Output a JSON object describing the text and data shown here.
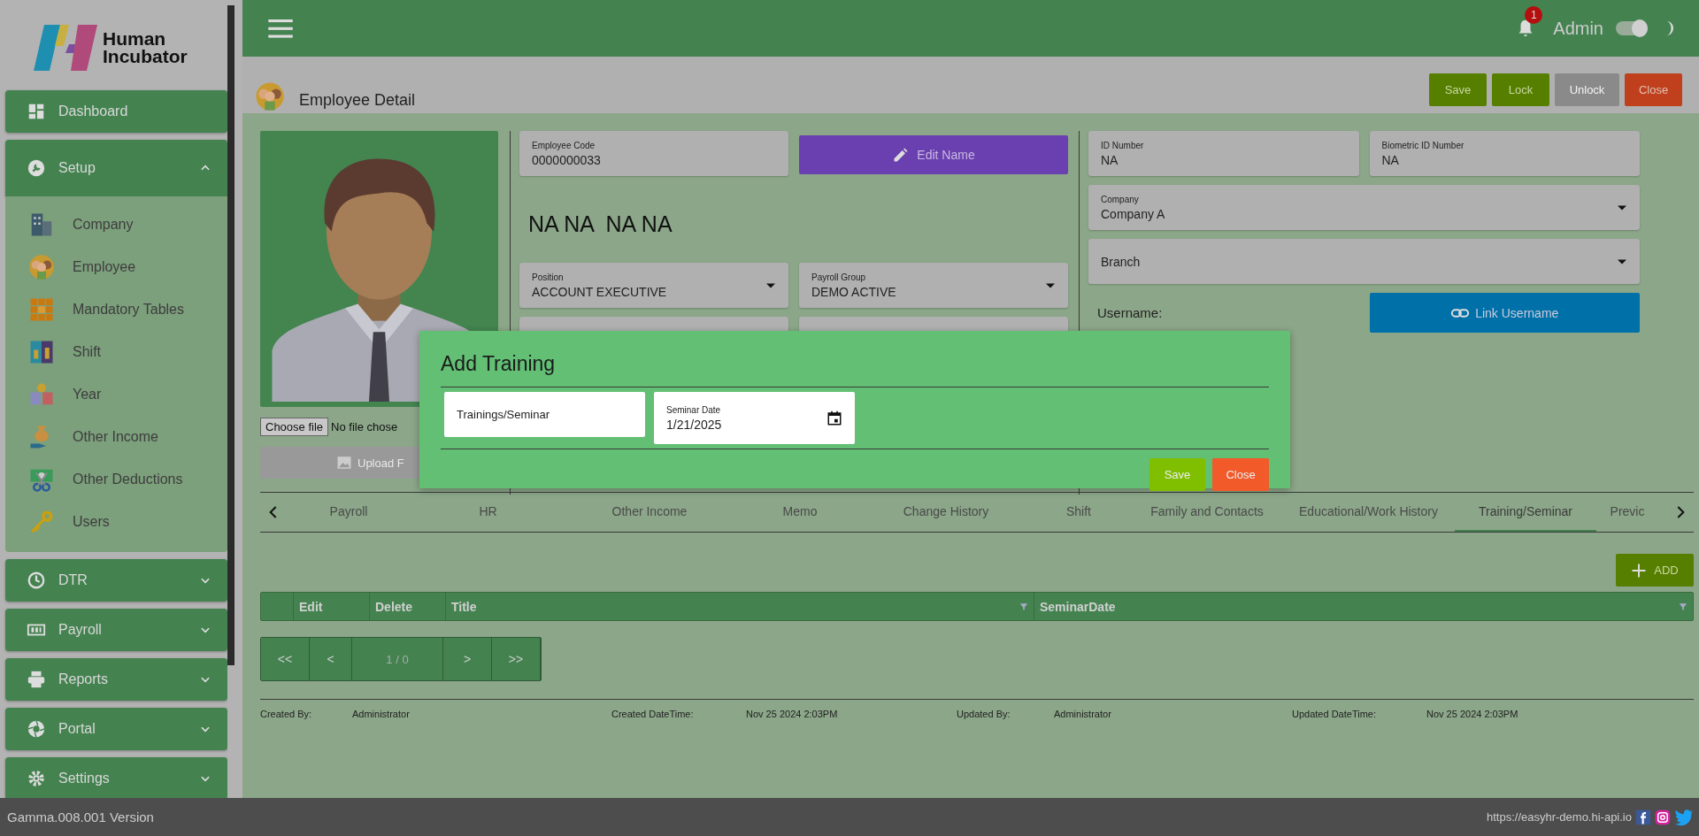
{
  "sidebar": {
    "logo": {
      "line1": "Human",
      "line2": "Incubator"
    },
    "items": [
      {
        "label": "Dashboard",
        "kind": "link"
      },
      {
        "label": "Setup",
        "kind": "group",
        "expanded": true,
        "children": [
          {
            "label": "Company"
          },
          {
            "label": "Employee"
          },
          {
            "label": "Mandatory Tables"
          },
          {
            "label": "Shift"
          },
          {
            "label": "Year"
          },
          {
            "label": "Other Income"
          },
          {
            "label": "Other Deductions"
          },
          {
            "label": "Users"
          }
        ]
      },
      {
        "label": "DTR",
        "kind": "group",
        "expanded": false
      },
      {
        "label": "Payroll",
        "kind": "group",
        "expanded": false
      },
      {
        "label": "Reports",
        "kind": "group",
        "expanded": false
      },
      {
        "label": "Portal",
        "kind": "group",
        "expanded": false
      },
      {
        "label": "Settings",
        "kind": "group",
        "expanded": false
      }
    ],
    "version": "Gamma.008.001 Version"
  },
  "topbar": {
    "notifications": "1",
    "user": "Admin",
    "theme_toggle": {
      "on": true
    }
  },
  "page": {
    "title": "Employee Detail",
    "actions": [
      {
        "label": "Save",
        "kind": "save",
        "disabled": false
      },
      {
        "label": "Lock",
        "kind": "save",
        "disabled": false
      },
      {
        "label": "Unlock",
        "kind": "save",
        "disabled": true
      },
      {
        "label": "Close",
        "kind": "close",
        "disabled": false
      }
    ]
  },
  "profile": {
    "choose_file": "Choose file",
    "file_status": "No file chose",
    "upload": "Upload F"
  },
  "employee": {
    "code": {
      "label": "Employee Code",
      "value": "0000000033"
    },
    "edit_name": "Edit Name",
    "name": "NA NA  NA NA",
    "position": {
      "label": "Position",
      "value": "ACCOUNT EXECUTIVE"
    },
    "payroll_group": {
      "label": "Payroll Group",
      "value": "DEMO ACTIVE"
    },
    "id_number": {
      "label": "ID Number",
      "value": "NA"
    },
    "biometric_id": {
      "label": "Biometric ID Number",
      "value": "NA"
    },
    "company": {
      "label": "Company",
      "value": "Company A"
    },
    "branch": {
      "placeholder": "Branch"
    },
    "username_label": "Username:",
    "link_username": "Link Username"
  },
  "tabs": [
    {
      "label": "Payroll",
      "selected": false
    },
    {
      "label": "HR",
      "selected": false
    },
    {
      "label": "Other Income",
      "selected": false
    },
    {
      "label": "Memo",
      "selected": false
    },
    {
      "label": "Change History",
      "selected": false
    },
    {
      "label": "Shift",
      "selected": false
    },
    {
      "label": "Family and Contacts",
      "selected": false
    },
    {
      "label": "Educational/Work History",
      "selected": false
    },
    {
      "label": "Training/Seminar",
      "selected": true
    },
    {
      "label": "Previc",
      "selected": false
    }
  ],
  "table": {
    "add": "ADD",
    "columns": [
      "Edit",
      "Delete",
      "Title",
      "SeminarDate"
    ]
  },
  "pager": {
    "first": "<<",
    "prev": "<",
    "page": "1 / 0",
    "next": ">",
    "last": ">>"
  },
  "audit": [
    {
      "label": "Created By:",
      "value": "Administrator"
    },
    {
      "label": "Created DateTime:",
      "value": "Nov 25 2024 2:03PM"
    },
    {
      "label": "Updated By:",
      "value": "Administrator"
    },
    {
      "label": "Updated DateTime:",
      "value": "Nov 25 2024 2:03PM"
    }
  ],
  "footer": {
    "url": "https://easyhr-demo.hi-api.io"
  },
  "modal": {
    "title": "Add Training",
    "fields": [
      {
        "kind": "text",
        "placeholder": "Trainings/Seminar"
      },
      {
        "kind": "date",
        "label": "Seminar Date",
        "value": "1/21/2025"
      }
    ],
    "buttons": [
      {
        "label": "Save",
        "kind": "save"
      },
      {
        "label": "Close",
        "kind": "close"
      }
    ]
  }
}
